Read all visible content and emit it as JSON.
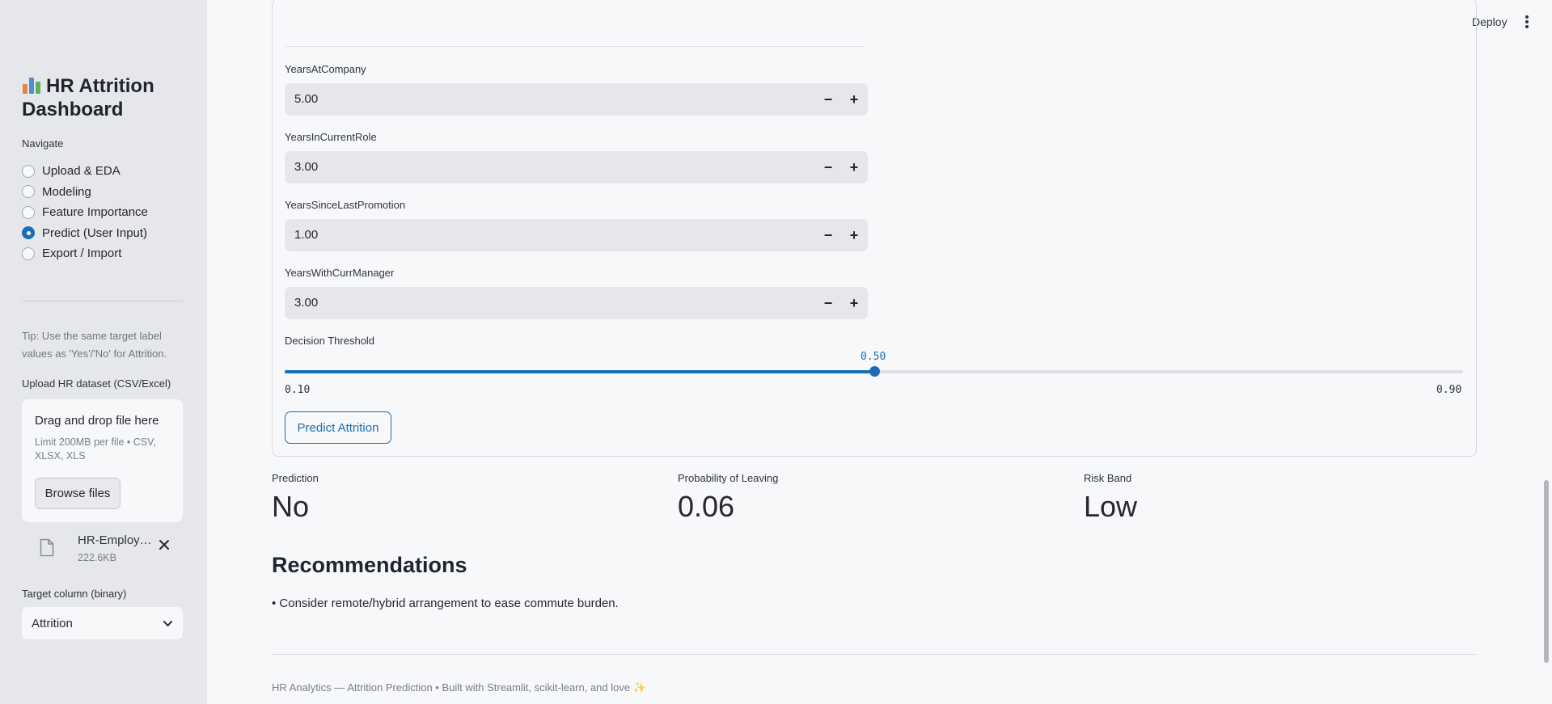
{
  "sidebar": {
    "title_icon": "bar-chart-emoji",
    "title": "HR Attrition Dashboard",
    "nav_label": "Navigate",
    "nav_items": [
      {
        "label": "Upload & EDA",
        "selected": false
      },
      {
        "label": "Modeling",
        "selected": false
      },
      {
        "label": "Feature Importance",
        "selected": false
      },
      {
        "label": "Predict (User Input)",
        "selected": true
      },
      {
        "label": "Export / Import",
        "selected": false
      }
    ],
    "tip": "Tip: Use the same target label values as 'Yes'/'No' for Attrition.",
    "upload": {
      "label": "Upload HR dataset (CSV/Excel)",
      "drop_title": "Drag and drop file here",
      "limit": "Limit 200MB per file • CSV, XLSX, XLS",
      "browse_label": "Browse files",
      "file_name": "HR-Employee-Attrition.csv",
      "file_display": "HR-Employ…",
      "file_size": "222.6KB",
      "file_icon": "file-icon",
      "close_icon": "close-icon"
    },
    "target": {
      "label": "Target column (binary)",
      "value": "Attrition",
      "icon": "chevron-down-icon"
    }
  },
  "header": {
    "deploy_label": "Deploy",
    "menu_icon": "kebab-menu-icon"
  },
  "form": {
    "fields": [
      {
        "label": "YearsAtCompany",
        "value": "5.00"
      },
      {
        "label": "YearsInCurrentRole",
        "value": "3.00"
      },
      {
        "label": "YearsSinceLastPromotion",
        "value": "1.00"
      },
      {
        "label": "YearsWithCurrManager",
        "value": "3.00"
      }
    ],
    "stepper": {
      "minus": "−",
      "plus": "+"
    },
    "threshold": {
      "label": "Decision Threshold",
      "value": "0.50",
      "min": "0.10",
      "max": "0.90",
      "fraction": 0.5
    },
    "predict_label": "Predict Attrition"
  },
  "metrics": [
    {
      "label": "Prediction",
      "value": "No"
    },
    {
      "label": "Probability of Leaving",
      "value": "0.06"
    },
    {
      "label": "Risk Band",
      "value": "Low"
    }
  ],
  "recommendations": {
    "heading": "Recommendations",
    "items": [
      "• Consider remote/hybrid arrangement to ease commute burden."
    ]
  },
  "footer": "HR Analytics — Attrition Prediction • Built with Streamlit, scikit-learn, and love ✨",
  "colors": {
    "accent": "#1c6db3",
    "sidebar_bg": "#e6e7ea",
    "main_bg": "#f7f8fa"
  }
}
